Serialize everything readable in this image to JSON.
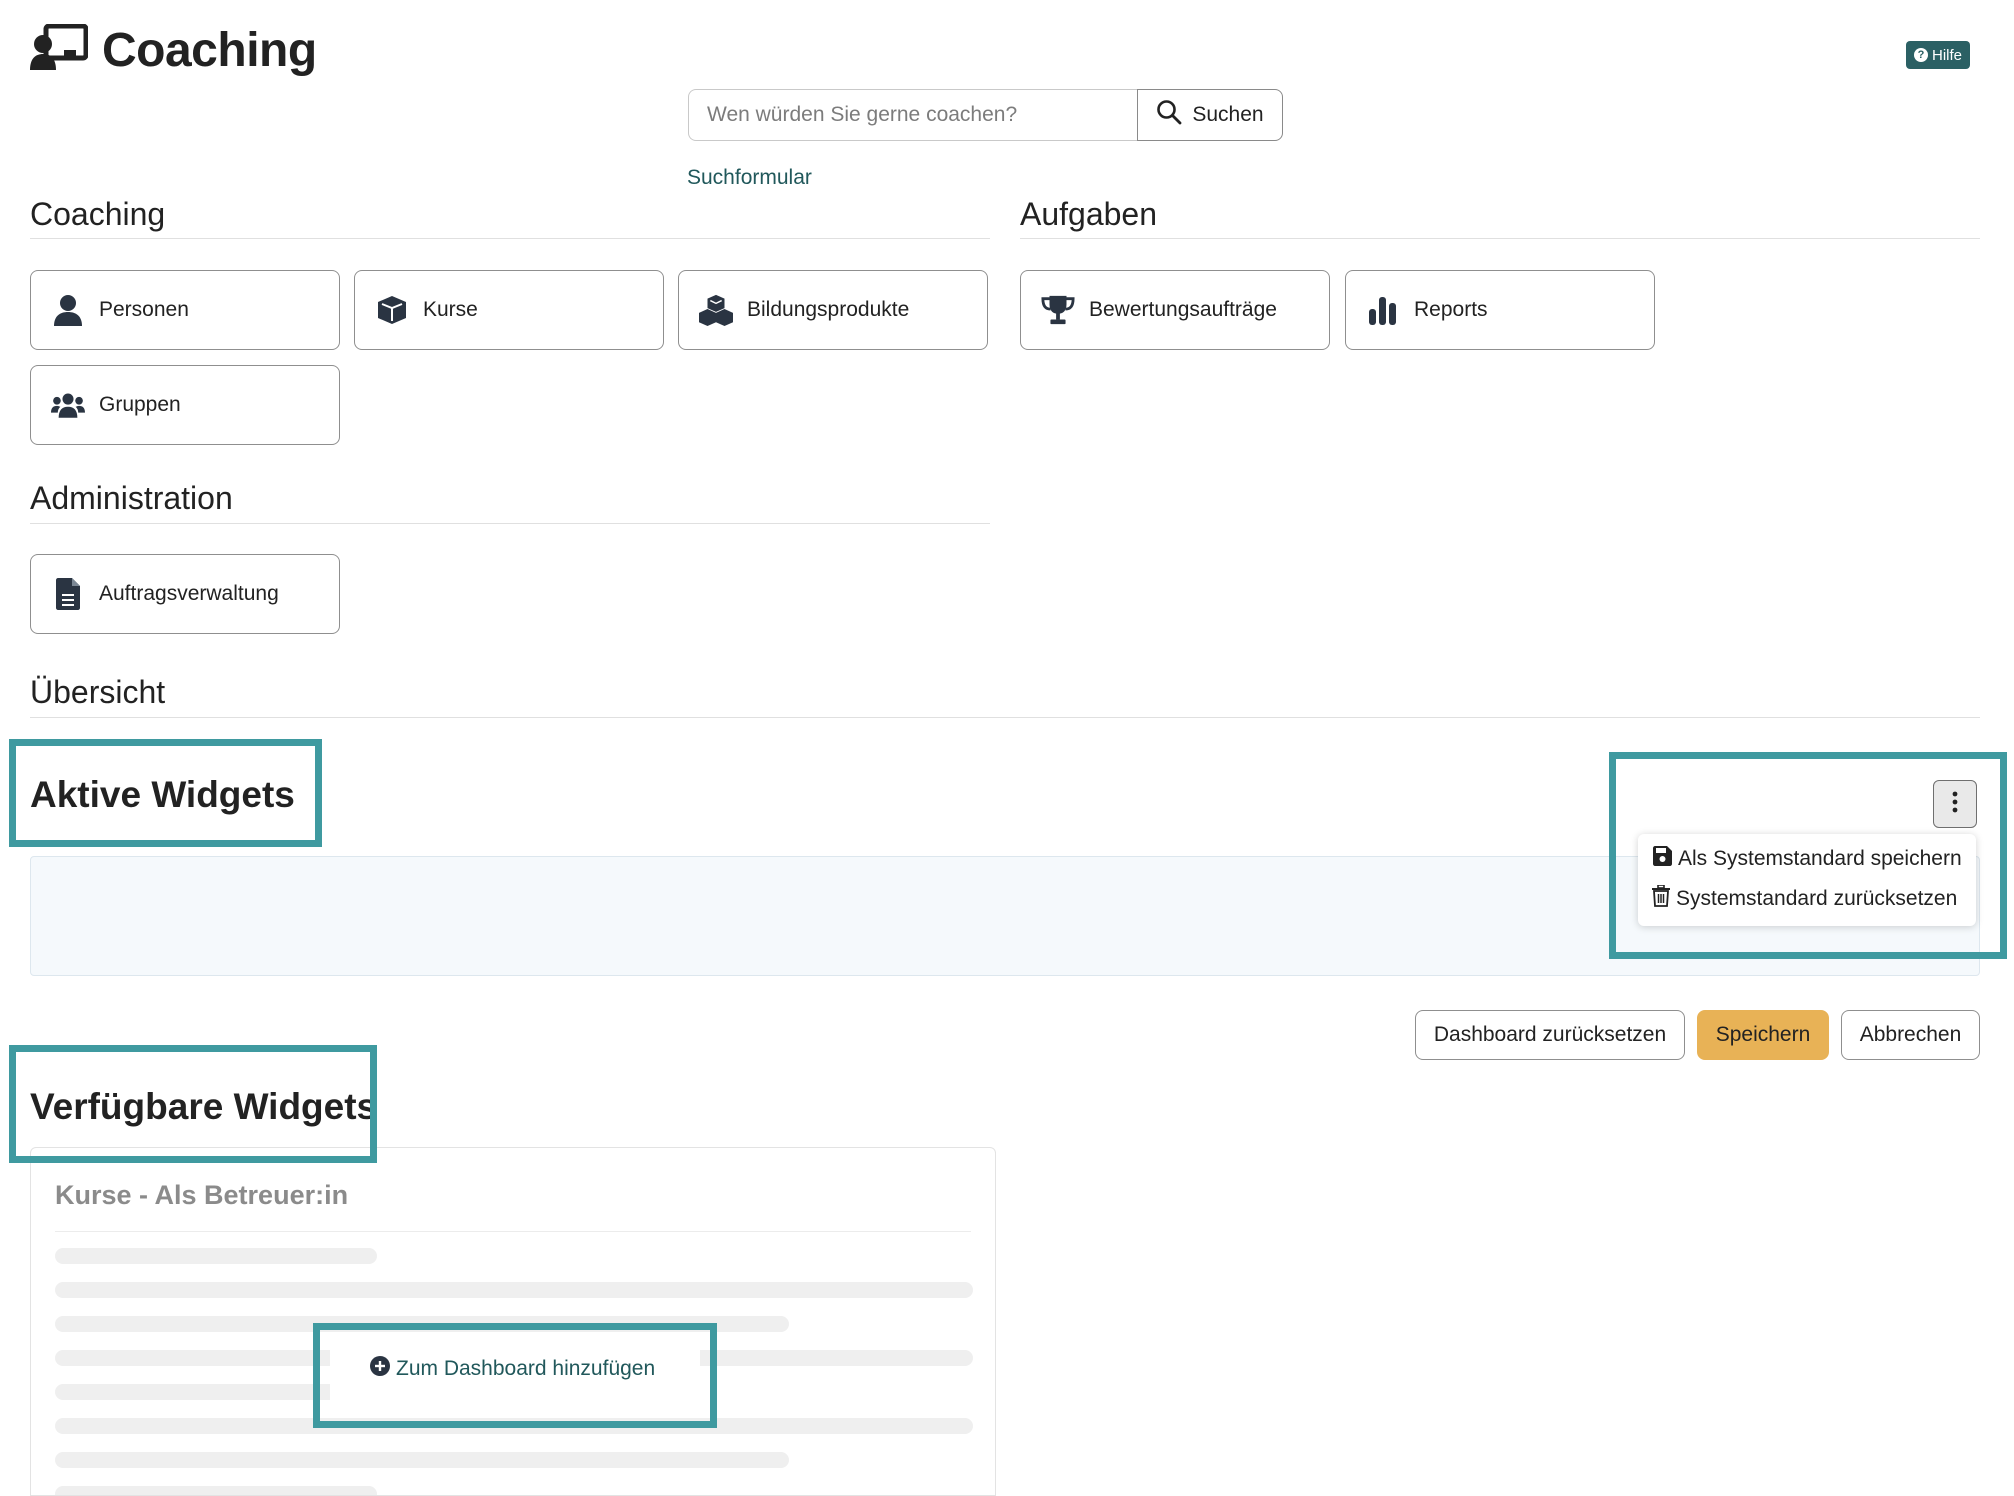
{
  "header": {
    "title": "Coaching",
    "help_label": "Hilfe"
  },
  "search": {
    "placeholder": "Wen würden Sie gerne coachen?",
    "button_label": "Suchen",
    "form_link": "Suchformular"
  },
  "sections": {
    "coaching": {
      "heading": "Coaching",
      "items": [
        {
          "label": "Personen",
          "icon": "person-icon"
        },
        {
          "label": "Kurse",
          "icon": "cube-icon"
        },
        {
          "label": "Bildungsprodukte",
          "icon": "cubes-icon"
        },
        {
          "label": "Gruppen",
          "icon": "users-icon"
        }
      ]
    },
    "tasks": {
      "heading": "Aufgaben",
      "items": [
        {
          "label": "Bewertungsaufträge",
          "icon": "trophy-icon"
        },
        {
          "label": "Reports",
          "icon": "bar-chart-icon"
        }
      ]
    },
    "administration": {
      "heading": "Administration",
      "items": [
        {
          "label": "Auftragsverwaltung",
          "icon": "document-icon"
        }
      ]
    },
    "overview": {
      "heading": "Übersicht"
    }
  },
  "active_widgets": {
    "title": "Aktive Widgets",
    "menu": [
      {
        "label": "Als Systemstandard speichern",
        "icon": "save-icon"
      },
      {
        "label": "Systemstandard zurücksetzen",
        "icon": "trash-icon"
      }
    ]
  },
  "actions": {
    "reset": "Dashboard zurücksetzen",
    "save": "Speichern",
    "cancel": "Abbrechen"
  },
  "available_widgets": {
    "title": "Verfügbare Widgets",
    "card_title": "Kurse - Als Betreuer:in",
    "add_label": "Zum Dashboard hinzufügen"
  },
  "colors": {
    "accent": "#21585b",
    "highlight": "#3f9aa0",
    "primary_button": "#e8b256",
    "help_badge": "#2b6064"
  }
}
